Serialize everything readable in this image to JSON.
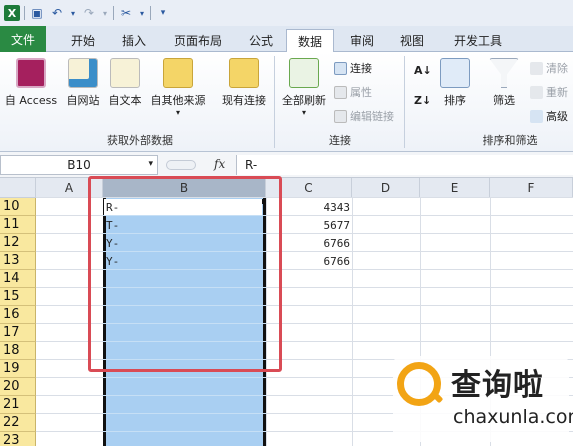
{
  "ribbon_tabs": [
    "文件",
    "开始",
    "插入",
    "页面布局",
    "公式",
    "数据",
    "审阅",
    "视图",
    "开发工具"
  ],
  "active_tab": "数据",
  "ribbon": {
    "external": {
      "access": "自 Access",
      "web": "自网站",
      "text": "自文本",
      "other": "自其他来源",
      "existing": "现有连接",
      "group_label": "获取外部数据"
    },
    "connections": {
      "refresh_all": "全部刷新",
      "connect": "连接",
      "properties": "属性",
      "edit_links": "编辑链接",
      "group_label": "连接"
    },
    "sort_filter": {
      "sort": "排序",
      "filter": "筛选",
      "clear": "清除",
      "reapply": "重新",
      "advanced": "高级",
      "group_label": "排序和筛选"
    }
  },
  "formula_bar": {
    "name_box": "B10",
    "fx_label": "fx",
    "content": "R-"
  },
  "grid": {
    "columns": [
      "A",
      "B",
      "C",
      "D",
      "E",
      "F"
    ],
    "selected_column": "B",
    "row_numbers": [
      "10",
      "11",
      "12",
      "13",
      "14",
      "15",
      "16",
      "17",
      "18",
      "19",
      "20",
      "21",
      "22",
      "23"
    ],
    "col_b": [
      "R-",
      "T-",
      "Y-",
      "Y-"
    ],
    "col_c": [
      "4343",
      "5677",
      "6766",
      "6766"
    ]
  },
  "watermark": {
    "name_cn": "查询啦",
    "name_en": "chaxunla.com"
  },
  "colors": {
    "file_tab": "#2a8a43",
    "row_header": "#f9e89f",
    "selection": "#a9cff2",
    "highlight_box": "#d94b55",
    "logo": "#f2a414"
  }
}
